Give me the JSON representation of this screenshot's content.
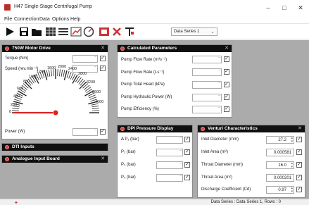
{
  "window": {
    "title": "H47 Single-Stage Centrifugal Pump",
    "minimize": "–",
    "maximize": "□",
    "close": "✕"
  },
  "menu": [
    "File",
    "Connection",
    "Data",
    "Options",
    "Help"
  ],
  "toolbar": {
    "series_select": "Data Series 1"
  },
  "motor": {
    "title": "750W Motor Drive",
    "torque_label": "Torque (Nm)",
    "speed_label": "Speed (rev.min⁻¹)",
    "power_label": "Power (W)",
    "gauge_ticks": [
      "0",
      "200",
      "400",
      "600",
      "800",
      "1000",
      "1200",
      "1600",
      "2000",
      "2400",
      "2800",
      "3200",
      "3600",
      "4000"
    ],
    "gauge_value": 0
  },
  "calc": {
    "title": "Calculated Parameters",
    "rows": [
      "Pump Flow Rate (m³s⁻¹)",
      "Pump Flow Rate (Ls⁻¹)",
      "Pump Total Head (kPa)",
      "Pump Hydraulic Power (W)",
      "Pump Efficiency (%)"
    ]
  },
  "dpi": {
    "title": "DPI Pressure Display",
    "rows": [
      "Δ P₁ (bar)",
      "P₂ (bar)",
      "P₃ (bar)",
      "P₄ (bar)"
    ]
  },
  "venturi": {
    "title": "Venturi Characteristics",
    "rows": [
      {
        "label": "Inlet Diameter (mm)",
        "value": "27.2"
      },
      {
        "label": "Inlet Area (m²)",
        "value": "0.000581"
      },
      {
        "label": "Throat Diameter (mm)",
        "value": "16.0"
      },
      {
        "label": "Throat Area (m²)",
        "value": "0.000201"
      },
      {
        "label": "Discharge Coefficient (Cd)",
        "value": "0.97"
      }
    ]
  },
  "dti": {
    "title": "DTI Inputs"
  },
  "analogue": {
    "title": "Analogue Input Board"
  },
  "status": {
    "text": "Data Series : Data Series 1,  Rows : 0"
  }
}
